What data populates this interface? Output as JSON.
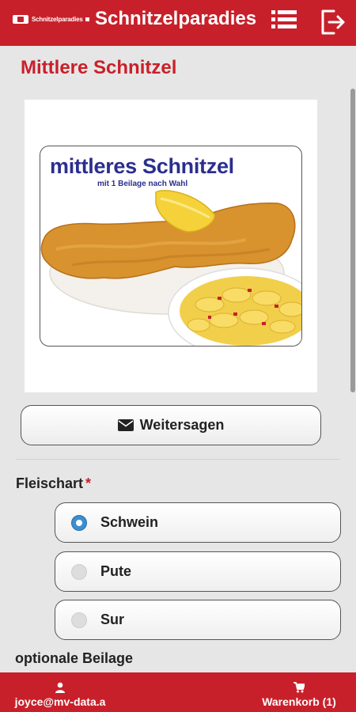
{
  "header": {
    "logo_text": "Schnitzelparadies",
    "title": "Schnitzelparadies",
    "menu_icon": "list-menu-icon",
    "logout_icon": "logout-icon"
  },
  "product": {
    "title": "Mittlere Schnitzel",
    "image_heading": "mittleres Schnitzel",
    "image_subheading": "mit 1 Beilage nach Wahl"
  },
  "share_button": {
    "label": "Weitersagen",
    "icon": "envelope-icon"
  },
  "meat_field": {
    "label": "Fleischart",
    "required_mark": "*",
    "options": [
      {
        "label": "Schwein",
        "selected": true
      },
      {
        "label": "Pute",
        "selected": false
      },
      {
        "label": "Sur",
        "selected": false
      }
    ]
  },
  "side_field": {
    "label": "optionale Beilage"
  },
  "footer": {
    "user_label": "joyce@mv-data.a",
    "user_icon": "user-icon",
    "cart_label": "Warenkorb (1)",
    "cart_icon": "cart-icon"
  },
  "colors": {
    "brand_red": "#c8202a",
    "radio_blue": "#3b8fce",
    "image_heading_blue": "#2b2f8f"
  }
}
